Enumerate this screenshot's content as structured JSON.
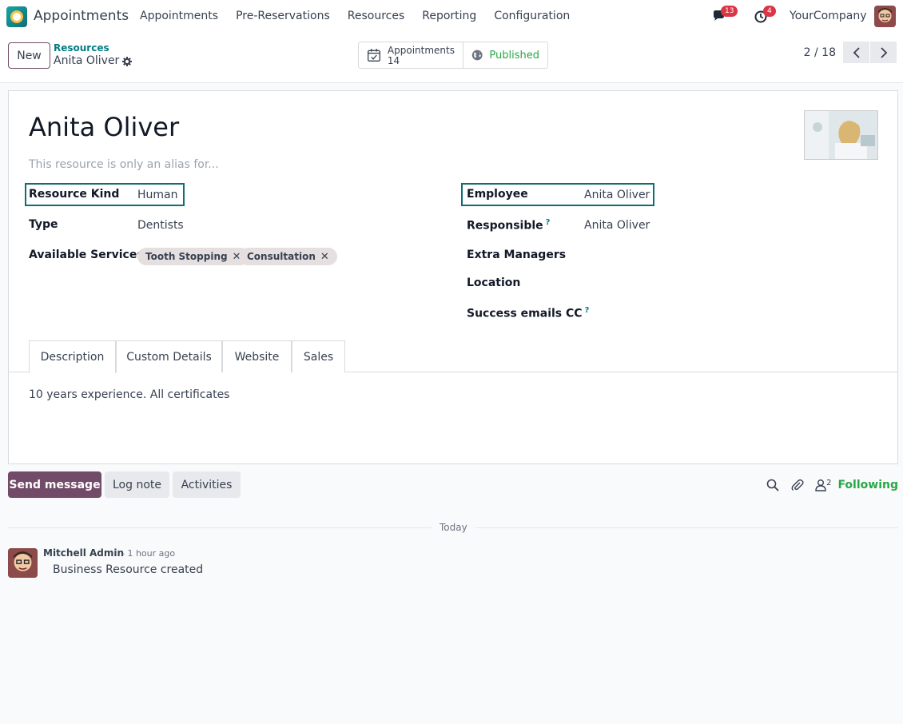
{
  "app": {
    "name": "Appointments"
  },
  "menu": [
    "Appointments",
    "Pre-Reservations",
    "Resources",
    "Reporting",
    "Configuration"
  ],
  "navbar": {
    "messages_count": "13",
    "activities_count": "4",
    "company": "YourCompany"
  },
  "control": {
    "new_label": "New",
    "breadcrumb_parent": "Resources",
    "breadcrumb_current": "Anita Oliver",
    "smart_appointments_label": "Appointments",
    "smart_appointments_value": "14",
    "smart_published_label": "Published",
    "pager": "2 / 18"
  },
  "record": {
    "title": "Anita Oliver",
    "alias_placeholder": "This resource is only an alias for...",
    "resource_kind_label": "Resource Kind",
    "resource_kind_value": "Human",
    "type_label": "Type",
    "type_value": "Dentists",
    "services_label": "Available Services",
    "services": [
      "Tooth Stopping",
      "Consultation"
    ],
    "employee_label": "Employee",
    "employee_value": "Anita Oliver",
    "responsible_label": "Responsible",
    "responsible_value": "Anita Oliver",
    "extra_managers_label": "Extra Managers",
    "location_label": "Location",
    "success_emails_label": "Success emails CC",
    "help_mark": "?"
  },
  "tabs": [
    "Description",
    "Custom Details",
    "Website",
    "Sales"
  ],
  "description": "10 years experience. All certificates",
  "chatter": {
    "send_label": "Send message",
    "log_label": "Log note",
    "activities_label": "Activities",
    "followers_count": "2",
    "following_label": "Following",
    "day_label": "Today",
    "message": {
      "author": "Mitchell Admin",
      "time": "- 1 hour ago",
      "body": "Business Resource created"
    }
  },
  "colors": {
    "brand": "#714b67",
    "accent": "#017e84",
    "highlight": "#0f6e73",
    "success": "#28a745",
    "badge": "#dc3545"
  }
}
